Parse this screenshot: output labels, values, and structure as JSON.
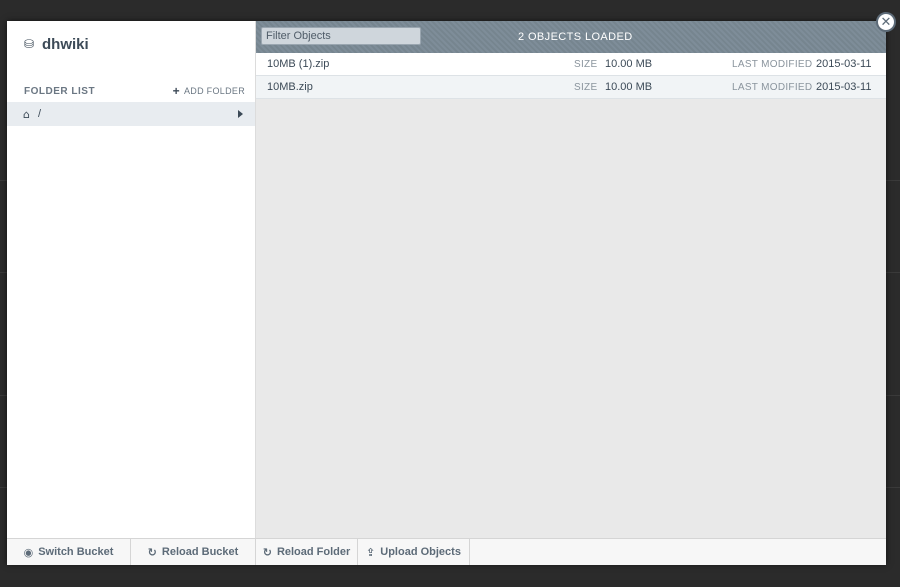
{
  "sidebar": {
    "bucket_name": "dhwiki",
    "folder_list_label": "FOLDER LIST",
    "add_folder_label": "ADD FOLDER",
    "folders": [
      {
        "path": "/"
      }
    ]
  },
  "main": {
    "filter_placeholder": "Filter Objects",
    "loaded_status": "2 OBJECTS LOADED",
    "files": [
      {
        "name": "10MB (1).zip",
        "size_label": "SIZE",
        "size": "10.00 MB",
        "modified_label": "LAST MODIFIED",
        "modified": "2015-03-11"
      },
      {
        "name": "10MB.zip",
        "size_label": "SIZE",
        "size": "10.00 MB",
        "modified_label": "LAST MODIFIED",
        "modified": "2015-03-11"
      }
    ]
  },
  "footer": {
    "switch_bucket": "Switch Bucket",
    "reload_bucket": "Reload Bucket",
    "reload_folder": "Reload Folder",
    "upload_objects": "Upload Objects"
  },
  "icons": {
    "bucket": "database-icon",
    "add": "plus-icon",
    "home": "home-icon",
    "close": "close-icon",
    "reload": "refresh-icon",
    "switch": "circle-icon",
    "upload": "upload-icon"
  }
}
